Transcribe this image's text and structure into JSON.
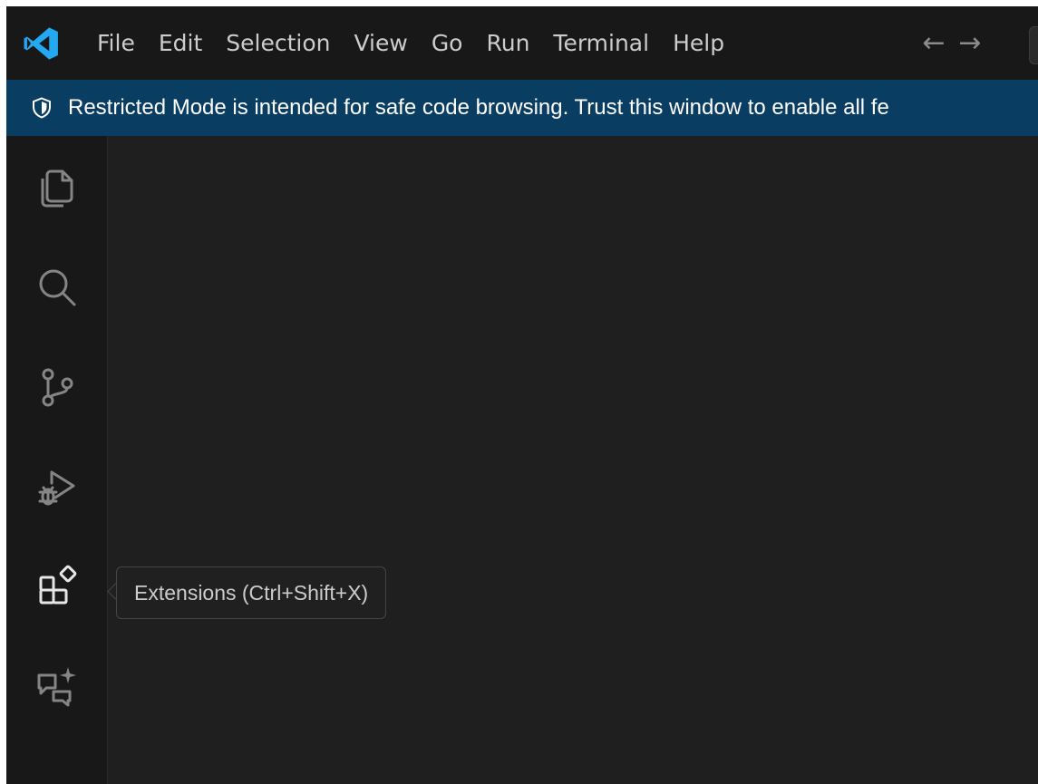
{
  "menubar": {
    "items": [
      "File",
      "Edit",
      "Selection",
      "View",
      "Go",
      "Run",
      "Terminal",
      "Help"
    ],
    "back_arrow": "←",
    "forward_arrow": "→"
  },
  "banner": {
    "icon": "shield-icon",
    "text": "Restricted Mode is intended for safe code browsing. Trust this window to enable all fe"
  },
  "activity_bar": {
    "items": [
      {
        "name": "explorer",
        "icon": "files-icon"
      },
      {
        "name": "search",
        "icon": "search-icon"
      },
      {
        "name": "source-control",
        "icon": "source-control-icon"
      },
      {
        "name": "run-and-debug",
        "icon": "run-debug-icon"
      },
      {
        "name": "extensions",
        "icon": "extensions-icon"
      },
      {
        "name": "chat",
        "icon": "chat-sparkle-icon"
      }
    ]
  },
  "tooltip": {
    "text": "Extensions (Ctrl+Shift+X)"
  },
  "colors": {
    "titlebar_bg": "#181818",
    "banner_bg": "#0a3d62",
    "editor_bg": "#1f1f1f",
    "logo_blue": "#23a9f2"
  }
}
